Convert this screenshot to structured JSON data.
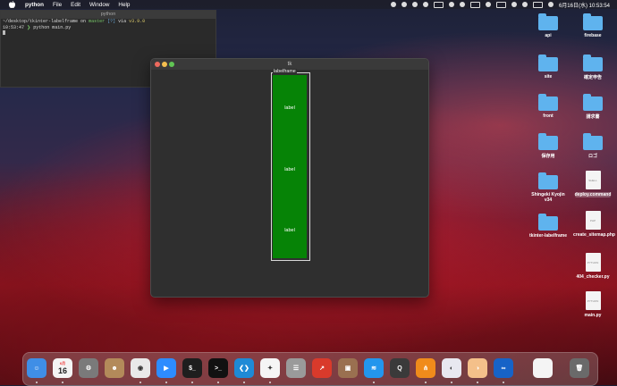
{
  "menubar": {
    "app_name": "python",
    "menus": [
      "File",
      "Edit",
      "Window",
      "Help"
    ],
    "clock": "6月16日(水)  10:53:54"
  },
  "terminal": {
    "title": "python",
    "prompt_path": "~/desktop/tkinter-labelframe",
    "prompt_on": "on",
    "branch": "master",
    "status": "[?]",
    "via": "via",
    "version": "v3.9.0",
    "time": "10:53:47",
    "command": "python main.py"
  },
  "tk_window": {
    "title": "tk",
    "labelframe_title": "labelframe",
    "labels": [
      "label",
      "label",
      "label"
    ],
    "colors": {
      "frame_bg": "#068306"
    }
  },
  "desktop_icons": [
    {
      "name": "api",
      "kind": "folder"
    },
    {
      "name": "firebase",
      "kind": "folder"
    },
    {
      "name": "site",
      "kind": "folder"
    },
    {
      "name": "確定申告",
      "kind": "folder"
    },
    {
      "name": "front",
      "kind": "folder"
    },
    {
      "name": "請求書",
      "kind": "folder"
    },
    {
      "name": "保存用",
      "kind": "folder"
    },
    {
      "name": "ロゴ",
      "kind": "folder"
    },
    {
      "name": "Shingeki Kyojin v34",
      "kind": "folder"
    },
    {
      "name": "deploy.command",
      "kind": "file",
      "tag": "SHELL"
    },
    {
      "name": "tkinter-labelframe",
      "kind": "folder"
    },
    {
      "name": "create_sitemap.php",
      "kind": "file",
      "tag": "PHP"
    },
    {
      "name": "404_checker.py",
      "kind": "file",
      "tag": "PYTHON"
    },
    {
      "name": "main.py",
      "kind": "file",
      "tag": "PYTHON"
    }
  ],
  "dock": [
    {
      "name": "finder-icon",
      "color": "#3f8ee6",
      "glyph": "☺"
    },
    {
      "name": "calendar-icon",
      "color": "#f4f4f4",
      "glyph": "16",
      "month": "6月"
    },
    {
      "name": "system-preferences-icon",
      "color": "#7a7a7a",
      "glyph": "⚙"
    },
    {
      "name": "contacts-icon",
      "color": "#b38a5a",
      "glyph": "☻"
    },
    {
      "name": "chrome-icon",
      "color": "#e9e9e9",
      "glyph": "◉"
    },
    {
      "name": "zoom-icon",
      "color": "#2d8cff",
      "glyph": "▶"
    },
    {
      "name": "iterm-icon",
      "color": "#1e1e1e",
      "glyph": "$_"
    },
    {
      "name": "terminal-icon",
      "color": "#111111",
      "glyph": ">_"
    },
    {
      "name": "vscode-icon",
      "color": "#1e8ad6",
      "glyph": "❮❯"
    },
    {
      "name": "safari-icon",
      "color": "#f5f5f5",
      "glyph": "✦"
    },
    {
      "name": "sequel-icon",
      "color": "#9a9a9a",
      "glyph": "☰"
    },
    {
      "name": "activity-icon",
      "color": "#d93a2b",
      "glyph": "↗"
    },
    {
      "name": "archive-icon",
      "color": "#9a7050",
      "glyph": "▣"
    },
    {
      "name": "docker-icon",
      "color": "#2396ed",
      "glyph": "≋"
    },
    {
      "name": "quicktime-icon",
      "color": "#3a3a3a",
      "glyph": "Q"
    },
    {
      "name": "sourcetree-icon",
      "color": "#f08b1b",
      "glyph": "⋔"
    },
    {
      "name": "github-desktop-icon",
      "color": "#e8e8f0",
      "glyph": "◐"
    },
    {
      "name": "preview-icon",
      "color": "#f4c08a",
      "glyph": "◑"
    },
    {
      "name": "infinity-icon",
      "color": "#1763c7",
      "glyph": "∞"
    },
    {
      "name": "document-icon",
      "color": "#f4f4f4",
      "glyph": ""
    },
    {
      "name": "trash-icon",
      "color": "#6a6a6a",
      "glyph": "🗑"
    }
  ]
}
